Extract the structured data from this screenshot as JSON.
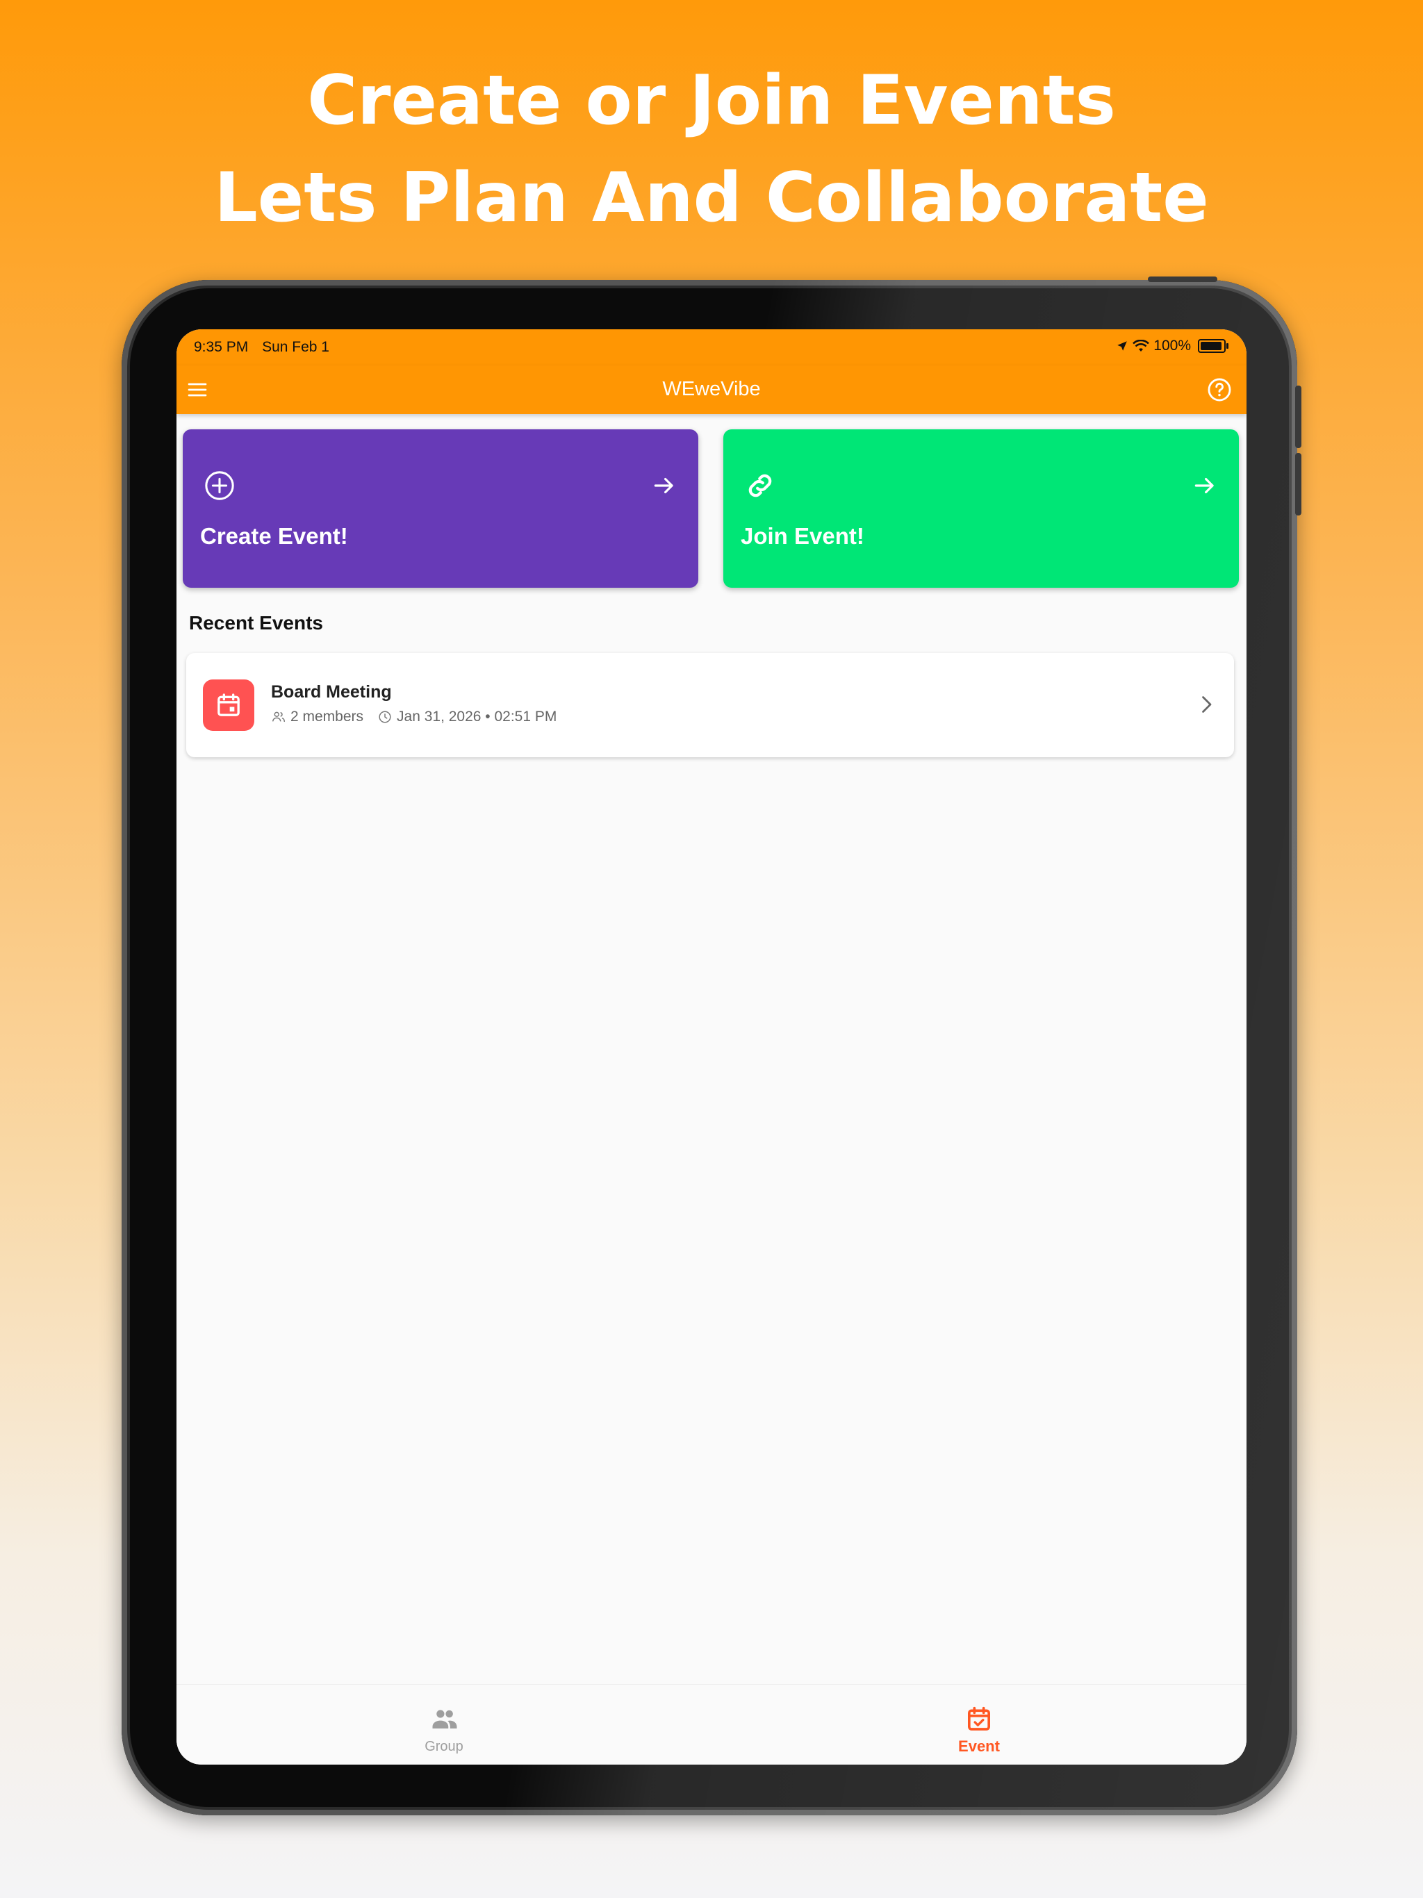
{
  "headline": {
    "line1": "Create or Join Events",
    "line2": "Lets Plan And Collaborate"
  },
  "status_bar": {
    "time": "9:35 PM",
    "date": "Sun Feb 1",
    "battery": "100%"
  },
  "app_bar": {
    "title": "WEweVibe",
    "menu_icon": "menu-icon",
    "help_icon": "help-circle-icon"
  },
  "actions": {
    "create": {
      "label": "Create Event!",
      "icon": "add-circle-icon",
      "color": "#673ab7"
    },
    "join": {
      "label": "Join Event!",
      "icon": "link-icon",
      "color": "#00e676"
    }
  },
  "recent": {
    "title": "Recent Events",
    "events": [
      {
        "title": "Board Meeting",
        "members": "2 members",
        "datetime": "Jan 31, 2026 • 02:51 PM",
        "icon_color": "#ff5252"
      }
    ]
  },
  "bottom_nav": {
    "items": [
      {
        "label": "Group",
        "icon": "group-icon",
        "active": false
      },
      {
        "label": "Event",
        "icon": "event-calendar-icon",
        "active": true
      }
    ],
    "active_color": "#ff5722"
  },
  "colors": {
    "brand_orange": "#ff9603"
  }
}
